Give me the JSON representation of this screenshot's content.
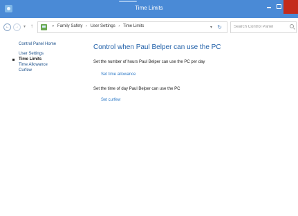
{
  "window": {
    "title": "Time Limits",
    "controls": {
      "minimize": "minimize",
      "maximize": "maximize",
      "close": "close"
    }
  },
  "addressbar": {
    "breadcrumbs": [
      "Family Safety",
      "User Settings",
      "Time Limits"
    ],
    "search_placeholder": "Search Control Panel"
  },
  "sidebar": {
    "home": "Control Panel Home",
    "items": [
      {
        "label": "User Settings",
        "active": false
      },
      {
        "label": "Time Limits",
        "active": true
      },
      {
        "label": "Time Allowance",
        "active": false
      },
      {
        "label": "Curfew",
        "active": false
      }
    ]
  },
  "main": {
    "heading": "Control when Paul Belper can use the PC",
    "sections": [
      {
        "text": "Set the number of hours Paul Belper can use the PC per day",
        "link": "Set time allowance"
      },
      {
        "text": "Set the time of day Paul Belper can use the PC",
        "link": "Set curfew"
      }
    ]
  },
  "colors": {
    "titlebar": "#4a8ad6",
    "close_button": "#c42b1c",
    "heading": "#1f5fa8",
    "link": "#2d79c7"
  },
  "icons": [
    "control-panel-icon",
    "back-icon",
    "forward-icon",
    "up-icon",
    "refresh-icon",
    "search-icon"
  ]
}
